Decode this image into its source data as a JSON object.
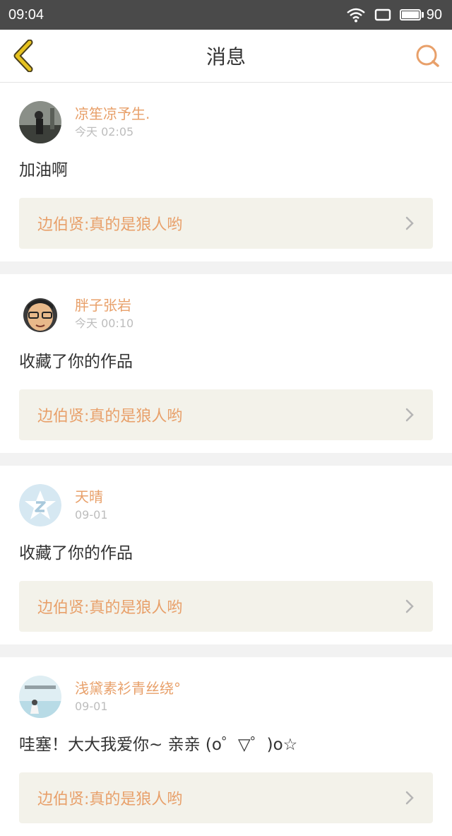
{
  "status_bar": {
    "time": "09:04",
    "battery": "90"
  },
  "header": {
    "title": "消息"
  },
  "colors": {
    "accent": "#e8a06a",
    "back_arrow": "#e6c21f",
    "ref_bg": "#f3f2ea"
  },
  "messages": [
    {
      "username": "凉笙凉予生.",
      "time": "今天 02:05",
      "content": "加油啊",
      "ref": "边伯贤:真的是狼人哟",
      "avatar_icon": "avatar-photo-dark"
    },
    {
      "username": "胖子张岩",
      "time": "今天 00:10",
      "content": "收藏了你的作品",
      "ref": "边伯贤:真的是狼人哟",
      "avatar_icon": "avatar-cartoon-face"
    },
    {
      "username": "天晴",
      "time": "09-01",
      "content": "收藏了你的作品",
      "ref": "边伯贤:真的是狼人哟",
      "avatar_icon": "avatar-default-star"
    },
    {
      "username": "浅黛素衫青丝绕°",
      "time": "09-01",
      "content": "哇塞！大大我爱你~ 亲亲 (o゜▽゜)o☆",
      "ref": "边伯贤:真的是狼人哟",
      "avatar_icon": "avatar-photo-light"
    }
  ]
}
